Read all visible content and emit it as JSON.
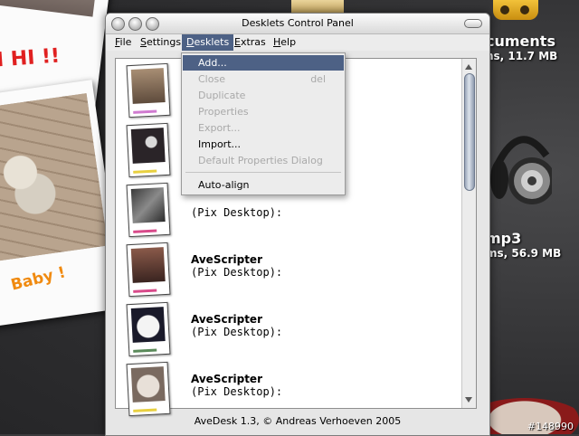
{
  "window": {
    "title": "Desklets Control Panel",
    "status": "AveDesk 1.3, © Andreas Verhoeven 2005"
  },
  "menubar": [
    {
      "label": "File",
      "acc": "F",
      "rest": "ile"
    },
    {
      "label": "Settings",
      "acc": "S",
      "rest": "ettings"
    },
    {
      "label": "Desklets",
      "acc": "D",
      "rest": "esklets"
    },
    {
      "label": "Extras",
      "acc": "E",
      "rest": "xtras"
    },
    {
      "label": "Help",
      "acc": "H",
      "rest": "elp"
    }
  ],
  "desklets_menu": {
    "add": "Add...",
    "close": "Close",
    "close_shortcut": "del",
    "duplicate": "Duplicate",
    "properties": "Properties",
    "export": "Export...",
    "import": "Import...",
    "default_properties": "Default Properties Dialog",
    "auto_align": "Auto-align"
  },
  "list": {
    "rows": [
      {
        "name": "",
        "sub": ""
      },
      {
        "name": "",
        "sub": ""
      },
      {
        "name": "",
        "sub": "(Pix Desktop):"
      },
      {
        "name": "AveScripter",
        "sub": "(Pix Desktop):"
      },
      {
        "name": "AveScripter",
        "sub": "(Pix Desktop):"
      },
      {
        "name": "AveScripter",
        "sub": "(Pix Desktop):"
      }
    ]
  },
  "desktop": {
    "hi_text": "I HI !!",
    "baby_text": "Baby !",
    "docs_name": "cuments",
    "docs_info": "ns, 11.7 MB",
    "mp3_name": "mp3",
    "mp3_info": "ms, 56.9 MB",
    "watermark": "#148990"
  },
  "colors": {
    "menu_highlight": "#4d6185",
    "disabled_text": "#a9a9a9"
  }
}
